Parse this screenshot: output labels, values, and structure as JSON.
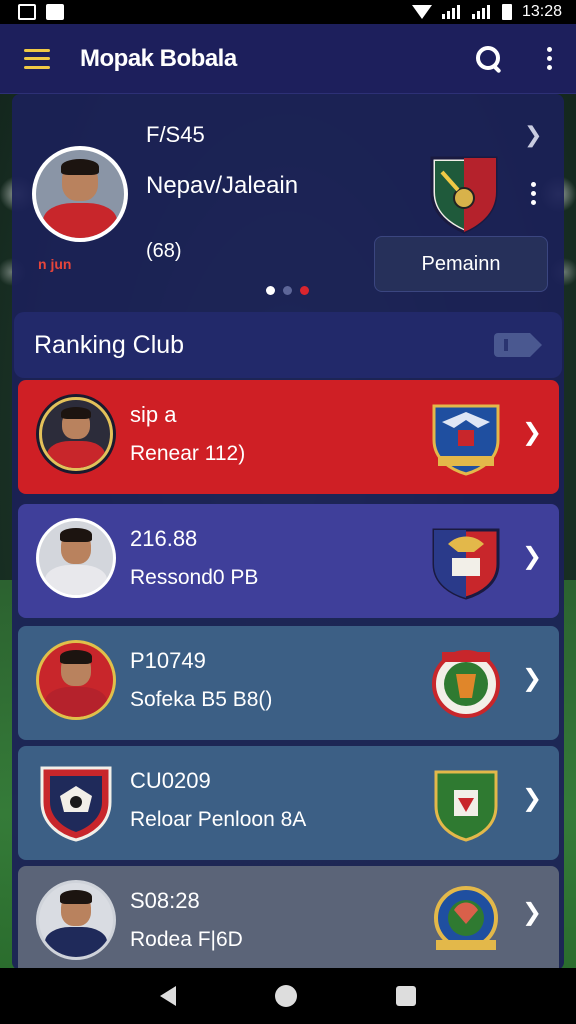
{
  "status_bar": {
    "time": "13:28"
  },
  "app_bar": {
    "title": "Mopak Bobala"
  },
  "featured": {
    "code": "F/S45",
    "name": "Nepav/Jaleain",
    "sub_label": "n jun",
    "count": "(68)",
    "button_label": "Pemainn",
    "page_indicator": {
      "pages": 3,
      "current": 1
    }
  },
  "ranking": {
    "title": "Ranking Club",
    "rows": [
      {
        "line1": "sip a",
        "line2": "Renear 112)",
        "bg": "#cf1f25"
      },
      {
        "line1": "216.88",
        "line2": "Ressond0 PB",
        "bg": "#3f3f9a"
      },
      {
        "line1": "P10749",
        "line2": "Sofeka B5 B8()",
        "bg": "#3c5f85"
      },
      {
        "line1": "CU0209",
        "line2": "Reloar Penloon 8A",
        "bg": "#3c5f85"
      },
      {
        "line1": "S08:28",
        "line2": "Rodea F|6D",
        "bg": "#5b6478"
      }
    ]
  },
  "colors": {
    "app_bar": "#1d1f5c",
    "panel": "#1b2158",
    "accent_red": "#cf1f25",
    "menu_accent": "#f0c945"
  },
  "icons": {
    "menu": "menu-icon",
    "search": "search-icon",
    "more": "more-vert-icon",
    "chevron": "chevron-right-icon",
    "tag": "tag-icon"
  }
}
